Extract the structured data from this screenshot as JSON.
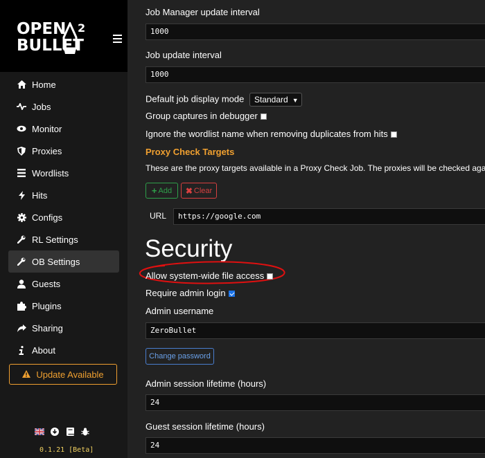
{
  "brand": {
    "line1": "OPEN",
    "line2": "BULLET",
    "sup": "2"
  },
  "sidebar": {
    "items": [
      {
        "label": "Home",
        "icon": "home-icon"
      },
      {
        "label": "Jobs",
        "icon": "pulse-icon"
      },
      {
        "label": "Monitor",
        "icon": "eye-icon"
      },
      {
        "label": "Proxies",
        "icon": "shield-icon"
      },
      {
        "label": "Wordlists",
        "icon": "list-icon"
      },
      {
        "label": "Hits",
        "icon": "bolt-icon"
      },
      {
        "label": "Configs",
        "icon": "gear-icon"
      },
      {
        "label": "RL Settings",
        "icon": "wrench-icon"
      },
      {
        "label": "OB Settings",
        "icon": "wrench-icon"
      },
      {
        "label": "Guests",
        "icon": "user-icon"
      },
      {
        "label": "Plugins",
        "icon": "puzzle-icon"
      },
      {
        "label": "Sharing",
        "icon": "share-icon"
      },
      {
        "label": "About",
        "icon": "info-icon"
      }
    ],
    "active_index": 8,
    "update_label": "Update Available",
    "version": "0.1.21 [Beta]"
  },
  "main": {
    "job_manager_label": "Job Manager update interval",
    "job_manager_value": "1000",
    "job_update_label": "Job update interval",
    "job_update_value": "1000",
    "display_mode_label": "Default job display mode",
    "display_mode_value": "Standard",
    "group_captures_label": "Group captures in debugger",
    "ignore_wordlist_label": "Ignore the wordlist name when removing duplicates from hits",
    "proxy_targets_title": "Proxy Check Targets",
    "proxy_targets_desc": "These are the proxy targets available in a Proxy Check Job. The proxies will be checked agai",
    "add_label": "Add",
    "clear_label": "Clear",
    "url_label": "URL",
    "url_value": "https://google.com",
    "security_title": "Security",
    "allow_file_access_label": "Allow system-wide file access",
    "require_login_label": "Require admin login",
    "admin_username_label": "Admin username",
    "admin_username_value": "ZeroBullet",
    "change_password_label": "Change password",
    "admin_session_label": "Admin session lifetime (hours)",
    "admin_session_value": "24",
    "guest_session_label": "Guest session lifetime (hours)",
    "guest_session_value": "24"
  },
  "colors": {
    "accent": "#f0a030",
    "annotation": "#e01010",
    "add": "#2ea04a",
    "clear": "#d84040",
    "link": "#6aa0e8"
  }
}
